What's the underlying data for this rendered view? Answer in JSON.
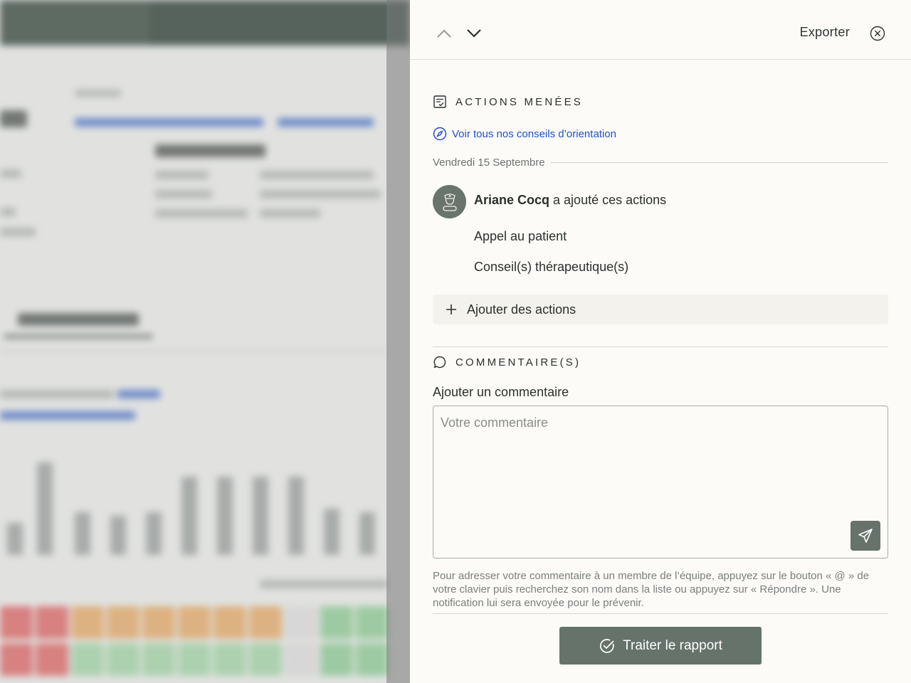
{
  "toolbar": {
    "prev_icon": "chevron-up-icon",
    "next_icon": "chevron-down-icon",
    "export_label": "Exporter",
    "close_icon": "close-circle-icon"
  },
  "actions_section": {
    "title": "ACTIONS MENÉES",
    "icon": "checklist-icon",
    "guidance_link": "Voir tous nos conseils d’orientation",
    "guidance_icon": "compass-icon",
    "date": "Vendredi 15 Septembre",
    "entry": {
      "author": "Ariane Cocq",
      "verb": " a ajouté ces actions",
      "avatar_icon": "nurse-avatar-icon",
      "actions": [
        "Appel au patient",
        "Conseil(s) thérapeutique(s)"
      ]
    },
    "add_label": "Ajouter des actions",
    "add_icon": "plus-icon"
  },
  "comments_section": {
    "title": "COMMENTAIRE(S)",
    "icon": "speech-bubble-icon",
    "field_label": "Ajouter un commentaire",
    "placeholder": "Votre commentaire",
    "value": "",
    "send_icon": "send-icon",
    "hint": "Pour adresser votre commentaire à un membre de l’équipe, appuyez sur le bouton « @ » de votre clavier puis recherchez son nom dans la liste ou appuyez sur « Répondre ». Une notification lui sera envoyée pour le prévenir."
  },
  "footer": {
    "submit_label": "Traiter le rapport",
    "submit_icon": "check-circle-icon"
  },
  "colors": {
    "panel_bg": "#fcfbf7",
    "primary": "#65736b",
    "link": "#2350c8",
    "text": "#2c302d",
    "muted": "#7b7f7d"
  }
}
